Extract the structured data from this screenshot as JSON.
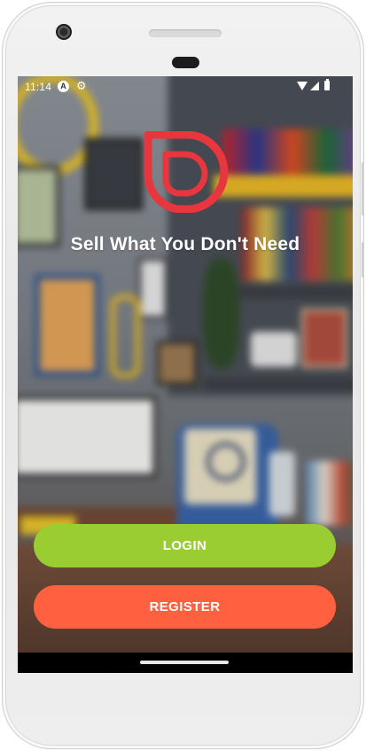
{
  "status_bar": {
    "time": "11:14",
    "icons": [
      "android-auto-icon",
      "gear-icon",
      "wifi-icon",
      "signal-icon",
      "battery-icon"
    ]
  },
  "app": {
    "logo": "d-logo-icon",
    "tagline": "Sell What You Don't Need",
    "login_label": "LOGIN",
    "register_label": "REGISTER"
  },
  "colors": {
    "brand_red": "#E8363F",
    "login_button": "#9ACD32",
    "register_button": "#FF6040",
    "text": "#FFFFFF",
    "nav_bar": "#000000"
  }
}
